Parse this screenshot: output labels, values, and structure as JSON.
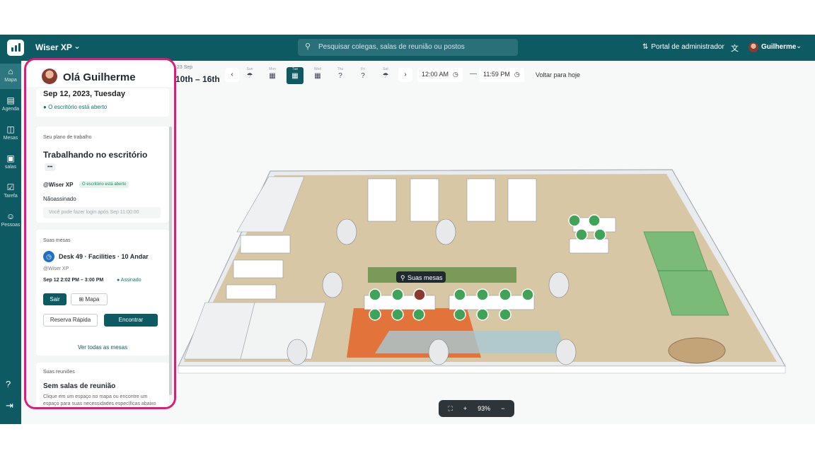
{
  "topbar": {
    "workspace": "Wiser XP",
    "search_placeholder": "Pesquisar colegas, salas de reunião ou postos",
    "admin_portal": "Portal de administrador",
    "user_name": "Guilherme"
  },
  "nav": {
    "items": [
      {
        "label": "Mapa",
        "icon": "home-icon"
      },
      {
        "label": "Agenda",
        "icon": "calendar-icon"
      },
      {
        "label": "Mesas",
        "icon": "desk-icon"
      },
      {
        "label": "salas",
        "icon": "room-icon"
      },
      {
        "label": "Tarefa",
        "icon": "task-icon"
      },
      {
        "label": "Pessoas",
        "icon": "people-icon"
      }
    ]
  },
  "dates": {
    "range_small": "23 Sep",
    "range": "10th – 16th",
    "days": [
      {
        "name": "Sun",
        "glyph": "☂"
      },
      {
        "name": "Mon",
        "glyph": "▦"
      },
      {
        "name": "Tue",
        "glyph": "▦"
      },
      {
        "name": "Wed",
        "glyph": "▦"
      },
      {
        "name": "Thu",
        "glyph": "?"
      },
      {
        "name": "Fri",
        "glyph": "?"
      },
      {
        "name": "Sat",
        "glyph": "☂"
      }
    ],
    "start_time": "12:00 AM",
    "end_time": "11:59 PM",
    "today_link": "Voltar para hoje"
  },
  "panel": {
    "greeting": "Olá Guilherme",
    "date_line": "Sep 12, 2023, Tuesday",
    "office_open": "O escritório está aberto",
    "plan_label": "Seu plano de trabalho",
    "plan_title": "Trabalhando no escritório",
    "plan_more": "•••",
    "workspace_tag": "@Wiser XP",
    "office_open_tag": "O escritório está aberto",
    "unsigned": "Nãoassinado",
    "login_hint": "Você pode fazer login após Sep 11:00:00",
    "desks_label": "Suas mesas",
    "desk_title": "Desk 49 · Facilities · 10 Andar",
    "desk_ws": "@Wiser XP",
    "desk_time": "Sep 12 2:02 PM – 3:00 PM",
    "desk_status": "Assinado",
    "btn_exit": "Sair",
    "btn_map": "Mapa",
    "btn_quick": "Reserva Rápida",
    "btn_find": "Encontrar",
    "see_all": "Ver todas as mesas",
    "meetings_label": "Suas reuniões",
    "meetings_title": "Sem salas de reunião",
    "meetings_hint": "Clique em um espaço no mapa ou encontre um espaço para suas necessidades específicas abaixo"
  },
  "map": {
    "your_desks_tooltip": "Suas mesas",
    "zoom": "93%"
  }
}
